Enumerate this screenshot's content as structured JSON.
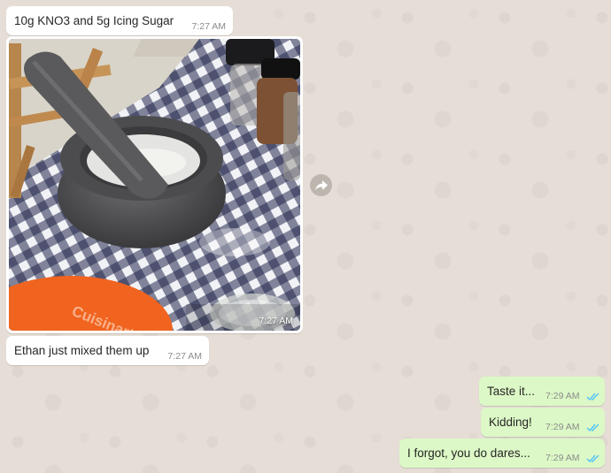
{
  "messages": [
    {
      "text": "10g KNO3 and 5g Icing Sugar",
      "time": "7:27 AM"
    },
    {
      "image_time": "7:27 AM"
    },
    {
      "text": "Ethan just mixed them up",
      "time": "7:27 AM"
    },
    {
      "text": "Taste it...",
      "time": "7:29 AM"
    },
    {
      "text": "Kidding!",
      "time": "7:29 AM"
    },
    {
      "text": "I forgot, you do dares...",
      "time": "7:29 AM"
    }
  ],
  "photo": {
    "brand_text": "Cuisinart"
  },
  "colors": {
    "incoming_bubble": "#ffffff",
    "outgoing_bubble": "#dcf8c6",
    "read_ticks": "#4fc3f7"
  }
}
